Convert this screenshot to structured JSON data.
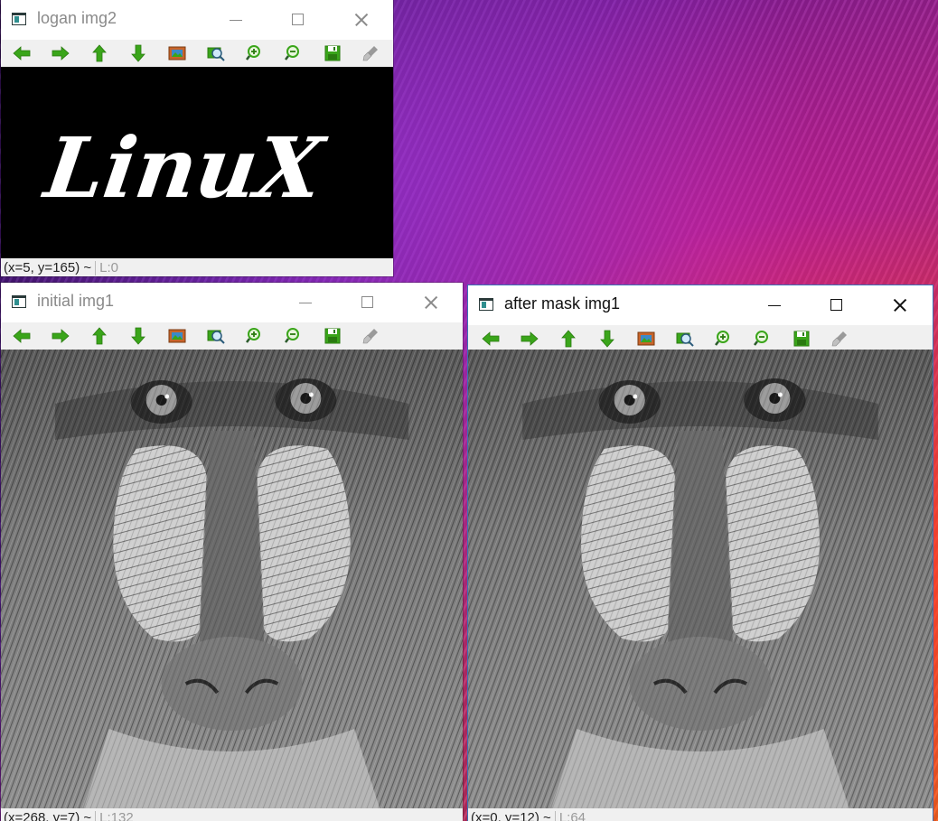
{
  "windows": {
    "logan": {
      "title": "logan img2",
      "status_coords": "(x=5, y=165) ~",
      "status_value": "L:0",
      "image_text": "LinuX"
    },
    "initial": {
      "title": "initial img1",
      "status_coords": "(x=268, y=7) ~",
      "status_value": "L:132"
    },
    "after": {
      "title": "after mask img1",
      "status_coords": "(x=0, y=12) ~",
      "status_value": "L:64"
    }
  },
  "toolbar": [
    {
      "name": "pan-left",
      "icon": "arrow-left-icon"
    },
    {
      "name": "pan-right",
      "icon": "arrow-right-icon"
    },
    {
      "name": "pan-up",
      "icon": "arrow-up-icon"
    },
    {
      "name": "pan-down",
      "icon": "arrow-down-icon"
    },
    {
      "name": "zoom-reset",
      "icon": "picture-icon"
    },
    {
      "name": "zoom-fit",
      "icon": "zoom-fit-icon"
    },
    {
      "name": "zoom-in",
      "icon": "zoom-in-icon"
    },
    {
      "name": "zoom-out",
      "icon": "zoom-out-icon"
    },
    {
      "name": "save",
      "icon": "save-icon"
    },
    {
      "name": "properties",
      "icon": "brush-icon"
    }
  ],
  "colors": {
    "arrow_green": "#3aa51a",
    "active_border": "#3b6fb6"
  }
}
